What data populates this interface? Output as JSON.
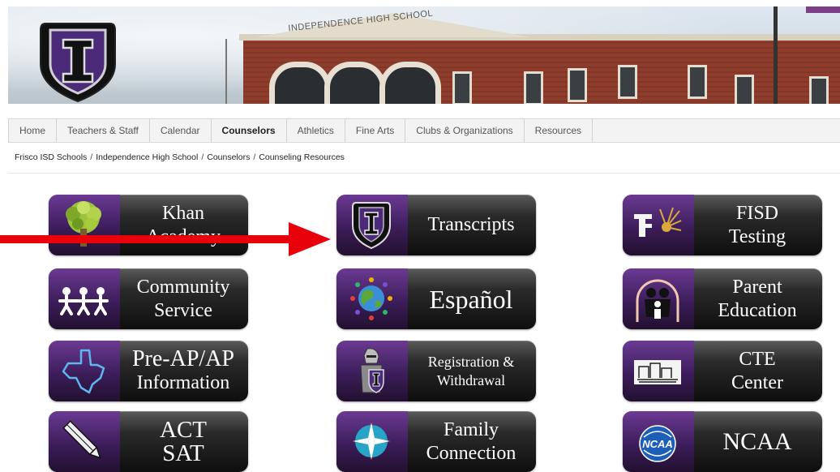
{
  "banner": {
    "building_sign": "INDEPENDENCE HIGH SCHOOL",
    "logo_letter": "I"
  },
  "nav": {
    "items": [
      {
        "label": "Home",
        "active": false
      },
      {
        "label": "Teachers & Staff",
        "active": false
      },
      {
        "label": "Calendar",
        "active": false
      },
      {
        "label": "Counselors",
        "active": true
      },
      {
        "label": "Athletics",
        "active": false
      },
      {
        "label": "Fine Arts",
        "active": false
      },
      {
        "label": "Clubs & Organizations",
        "active": false
      },
      {
        "label": "Resources",
        "active": false
      }
    ]
  },
  "breadcrumb": {
    "items": [
      "Frisco ISD Schools",
      "Independence High School",
      "Counselors",
      "Counseling Resources"
    ],
    "separator": "/"
  },
  "tiles": [
    {
      "id": "khan",
      "line1": "Khan",
      "line2": "Academy",
      "icon": "tree-icon"
    },
    {
      "id": "transcripts",
      "line1": "Transcripts",
      "line2": "",
      "icon": "shield-logo-icon"
    },
    {
      "id": "fisd-testing",
      "line1": "FISD",
      "line2": "Testing",
      "icon": "fisd-logo-icon"
    },
    {
      "id": "community",
      "line1": "Community",
      "line2": "Service",
      "icon": "people-chain-icon"
    },
    {
      "id": "espanol",
      "line1": "Español",
      "line2": "",
      "icon": "globe-people-icon"
    },
    {
      "id": "parent",
      "line1": "Parent",
      "line2": "Education",
      "icon": "family-icon"
    },
    {
      "id": "preap",
      "line1": "Pre-AP/AP",
      "line2": "Information",
      "icon": "texas-map-icon"
    },
    {
      "id": "registration",
      "line1": "Registration &",
      "line2": "Withdrawal",
      "icon": "knight-icon"
    },
    {
      "id": "cte",
      "line1": "CTE",
      "line2": "Center",
      "icon": "building-icon"
    },
    {
      "id": "act-sat",
      "line1": "ACT",
      "line2": "SAT",
      "icon": "pencil-icon"
    },
    {
      "id": "family",
      "line1": "Family",
      "line2": "Connection",
      "icon": "compass-star-icon"
    },
    {
      "id": "ncaa",
      "line1": "NCAA",
      "line2": "",
      "icon": "ncaa-logo-icon"
    }
  ],
  "ncaa_badge": "NCAA",
  "colors": {
    "annotation_arrow": "#e8000b",
    "tile_purple": "#4a2570",
    "nav_bg": "#f3f3f3"
  }
}
